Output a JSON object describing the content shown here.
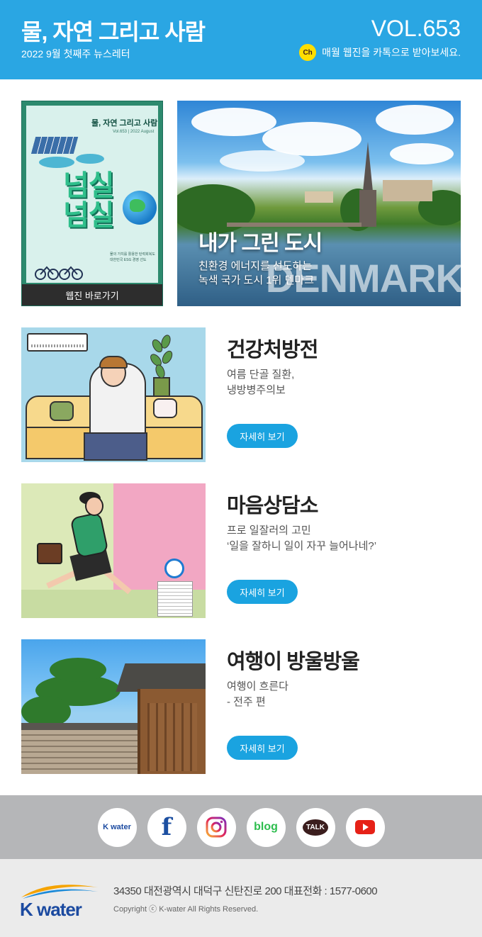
{
  "header": {
    "title": "물, 자연 그리고 사람",
    "subtitle": "2022 9월 첫째주 뉴스레터",
    "vol": "VOL.653",
    "kakao_icon": "Ch",
    "kakao_text": "매월 웹진을 카톡으로 받아보세요."
  },
  "webzine": {
    "cover_title": "물, 자연 그리고 사람",
    "cover_vol": "Vol.653 | 2022 August",
    "cover_headline_1": "넘실",
    "cover_headline_2": "넘실",
    "cover_desc": "물의 가치를 활용한 탄력회복도 대한민국 ESG 경영 선도",
    "label": "웹진 바로가기"
  },
  "feature": {
    "title": "내가 그린 도시",
    "desc": "친환경 에너지를 선도하는\n녹색 국가 도시 1위 덴마크",
    "watermark": "DENMARK"
  },
  "articles": [
    {
      "title": "건강처방전",
      "desc": "여름 단골 질환,\n냉방병주의보",
      "button": "자세히 보기"
    },
    {
      "title": "마음상담소",
      "desc": "프로 일잘러의 고민\n‘일을 잘하니 일이 자꾸 늘어나네?’",
      "button": "자세히 보기"
    },
    {
      "title": "여행이 방울방울",
      "desc": "여행이 흐른다\n- 전주 편",
      "button": "자세히 보기"
    }
  ],
  "social": {
    "kwater": "K water",
    "facebook": "f",
    "instagram": "instagram-icon",
    "blog": "blog",
    "talk": "TALK",
    "youtube": "youtube-icon"
  },
  "footer": {
    "logo": "K water",
    "address": "34350 대전광역시 대덕구 신탄진로 200   대표전화 : 1577-0600",
    "copyright": "Copyright ⓒ K-water All Rights Reserved."
  },
  "colors": {
    "header_bg": "#2aa6e3",
    "button_bg": "#1aa3e0",
    "social_bg": "#b5b6b8",
    "footer_bg": "#ebebeb"
  }
}
